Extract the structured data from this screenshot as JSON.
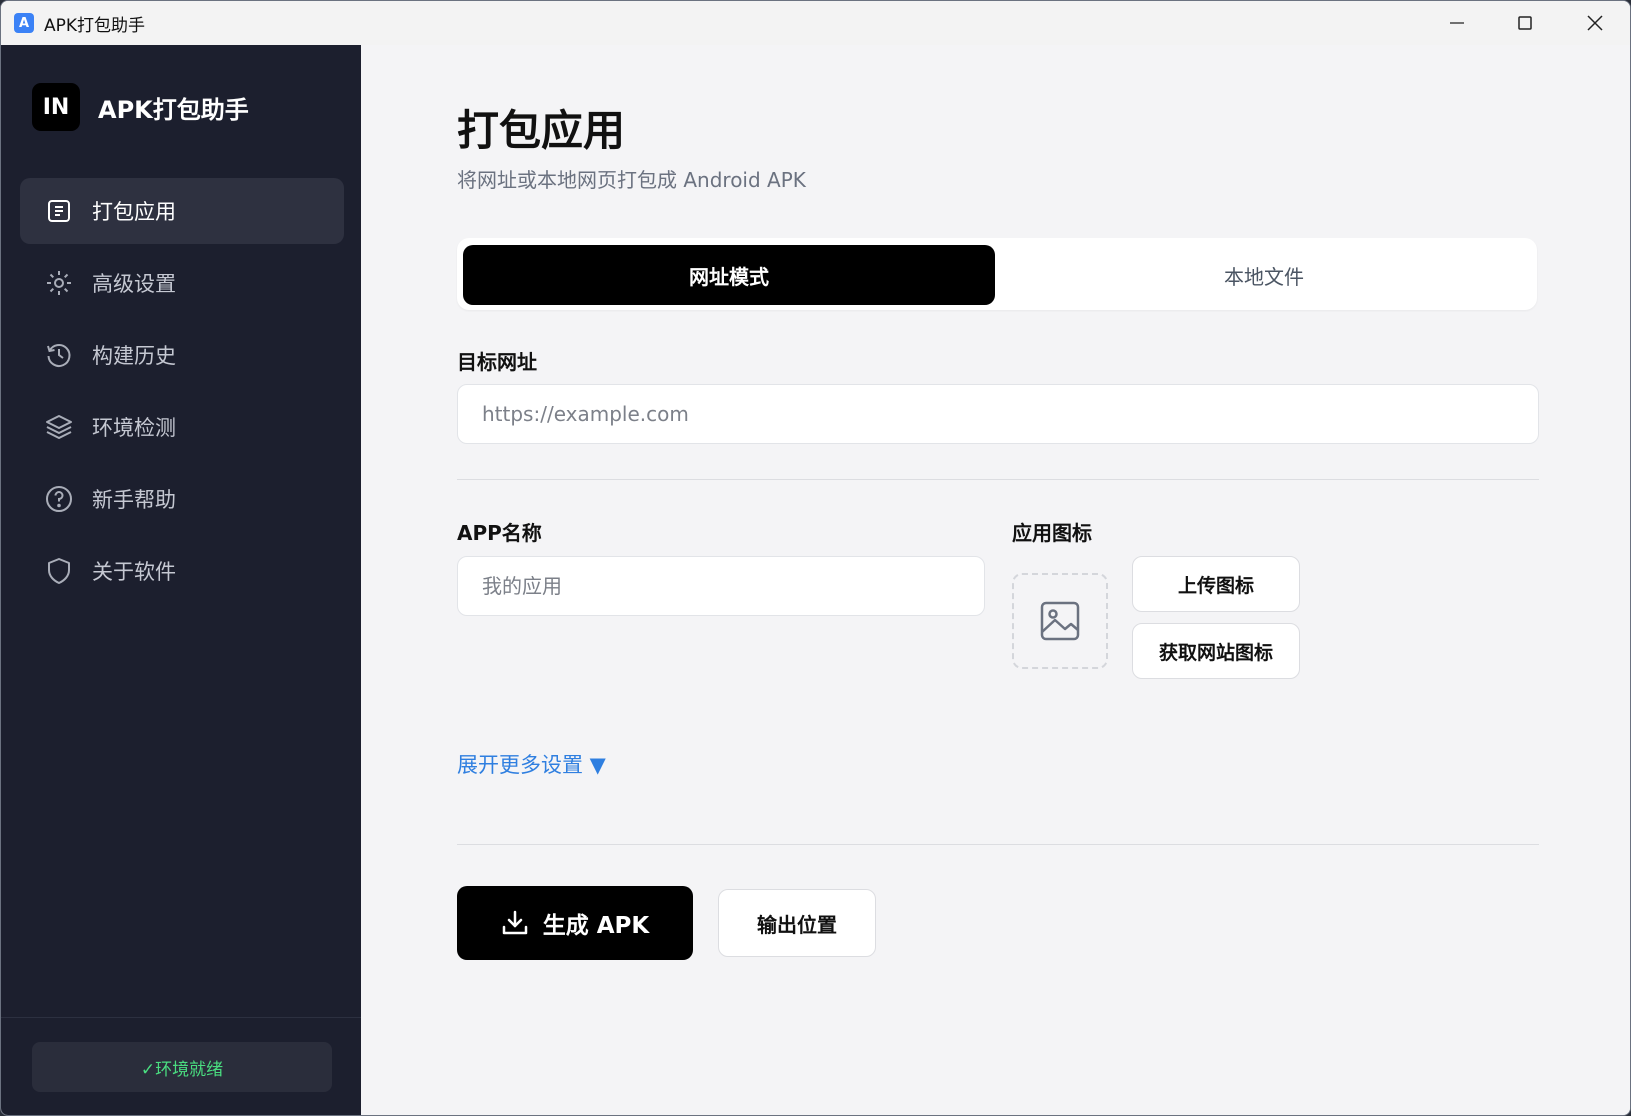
{
  "window": {
    "title": "APK打包助手",
    "app_icon_letter": "A"
  },
  "sidebar": {
    "logo_text": "IN",
    "brand_name": "APK打包助手",
    "items": [
      {
        "label": "打包应用",
        "icon": "document-icon",
        "active": true
      },
      {
        "label": "高级设置",
        "icon": "gear-icon",
        "active": false
      },
      {
        "label": "构建历史",
        "icon": "history-icon",
        "active": false
      },
      {
        "label": "环境检测",
        "icon": "layers-icon",
        "active": false
      },
      {
        "label": "新手帮助",
        "icon": "help-circle-icon",
        "active": false
      },
      {
        "label": "关于软件",
        "icon": "shield-icon",
        "active": false
      }
    ],
    "env_status": "✓环境就绪"
  },
  "main": {
    "title": "打包应用",
    "subtitle": "将网址或本地网页打包成 Android APK",
    "tabs": {
      "url_mode": "网址模式",
      "local_file": "本地文件",
      "active": "url_mode"
    },
    "target_url": {
      "label": "目标网址",
      "placeholder": "https://example.com",
      "value": ""
    },
    "app_name": {
      "label": "APP名称",
      "placeholder": "我的应用",
      "value": ""
    },
    "app_icon": {
      "label": "应用图标",
      "upload_label": "上传图标",
      "fetch_label": "获取网站图标"
    },
    "expand_more": "展开更多设置 ▼",
    "generate_label": "生成 APK",
    "output_label": "输出位置"
  },
  "colors": {
    "sidebar_bg": "#1c1f2e",
    "sidebar_active": "#2e3140",
    "main_bg": "#f4f4f6",
    "primary": "#000000",
    "link": "#2f7fe0",
    "success": "#4ade80"
  }
}
